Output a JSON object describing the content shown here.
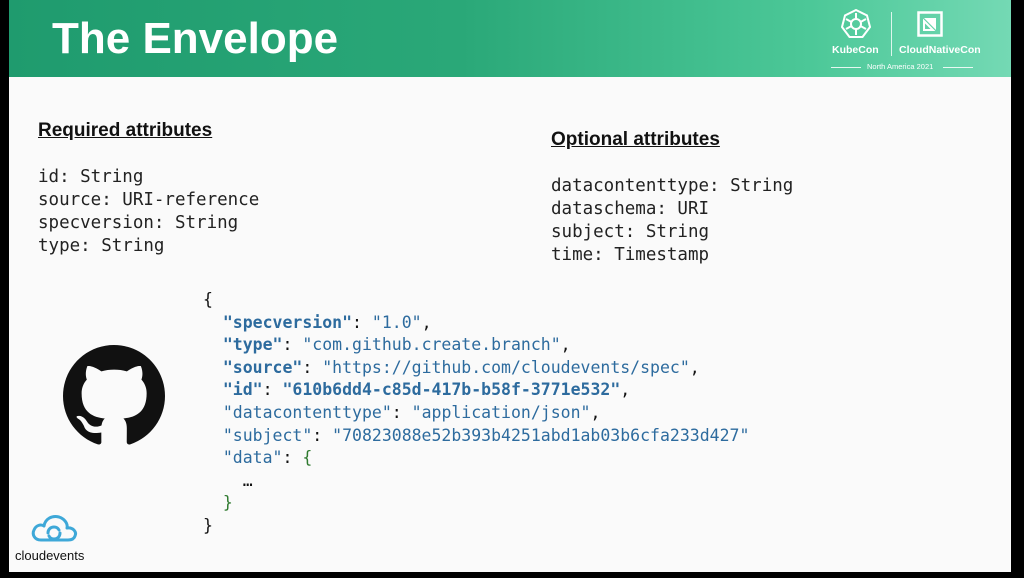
{
  "slide": {
    "title": "The Envelope",
    "brand": {
      "kubecon": "KubeCon",
      "cloudnativecon": "CloudNativeCon",
      "event": "North America 2021"
    },
    "required": {
      "heading": "Required attributes",
      "lines": [
        "id: String",
        "source: URI-reference",
        "specversion: String",
        "type: String"
      ]
    },
    "optional": {
      "heading": "Optional attributes",
      "lines": [
        "datacontenttype: String",
        "dataschema: URI",
        "subject: String",
        "time: Timestamp"
      ]
    },
    "json_example": {
      "open_brace": "{",
      "close_brace": "}",
      "entries": [
        {
          "key": "\"specversion\"",
          "value": "\"1.0\"",
          "trail": ","
        },
        {
          "key": "\"type\"",
          "value": "\"com.github.create.branch\"",
          "trail": ","
        },
        {
          "key": "\"source\"",
          "value": "\"https://github.com/cloudevents/spec\"",
          "trail": ","
        },
        {
          "key": "\"id\"",
          "value": "\"610b6dd4-c85d-417b-b58f-3771e532\"",
          "trail": ","
        },
        {
          "key": "\"datacontenttype\"",
          "value": "\"application/json\"",
          "trail": ","
        },
        {
          "key": "\"subject\"",
          "value": "\"70823088e52b393b4251abd1ab03b6cfa233d427\"",
          "trail": ""
        },
        {
          "key": "\"data\"",
          "value": "{",
          "trail": ""
        }
      ],
      "ellipsis": "…",
      "data_close": "}"
    },
    "cloudevents_label": "cloudevents"
  },
  "icons": [
    "kubecon-helm-icon",
    "cncf-icon",
    "github-octocat-icon",
    "cloudevents-cloud-icon"
  ],
  "colors": {
    "header_start": "#1f9b6e",
    "header_end": "#74d9b4",
    "json_key": "#2d6b9e",
    "json_brace_green": "#2f7a2f"
  }
}
